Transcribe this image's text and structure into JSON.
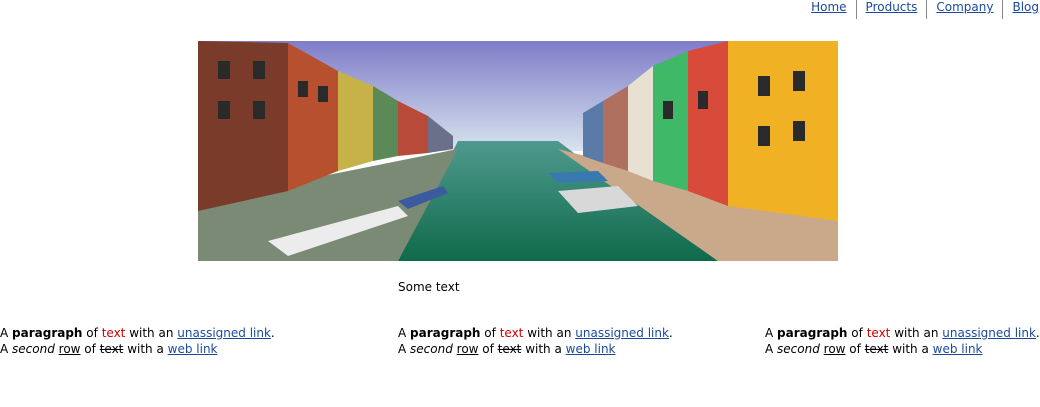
{
  "nav": {
    "items": [
      "Home",
      "Products",
      "Company",
      "Blog"
    ]
  },
  "hero": {
    "alt": "Canal with colorful houses and boats"
  },
  "caption": "Some text",
  "paragraph": {
    "line1": {
      "a": "A ",
      "bold": "paragraph",
      "of": " of ",
      "red": "text",
      "with": " with an ",
      "link": "unassigned link",
      "end": "."
    },
    "line2": {
      "a": "A ",
      "italic": "second",
      "sp": " ",
      "underline": "row",
      "of": " of ",
      "strike": "text",
      "with": " with a ",
      "link": "web link"
    }
  },
  "colors": {
    "link": "#1a4a9c",
    "highlight": "#cc0000"
  }
}
